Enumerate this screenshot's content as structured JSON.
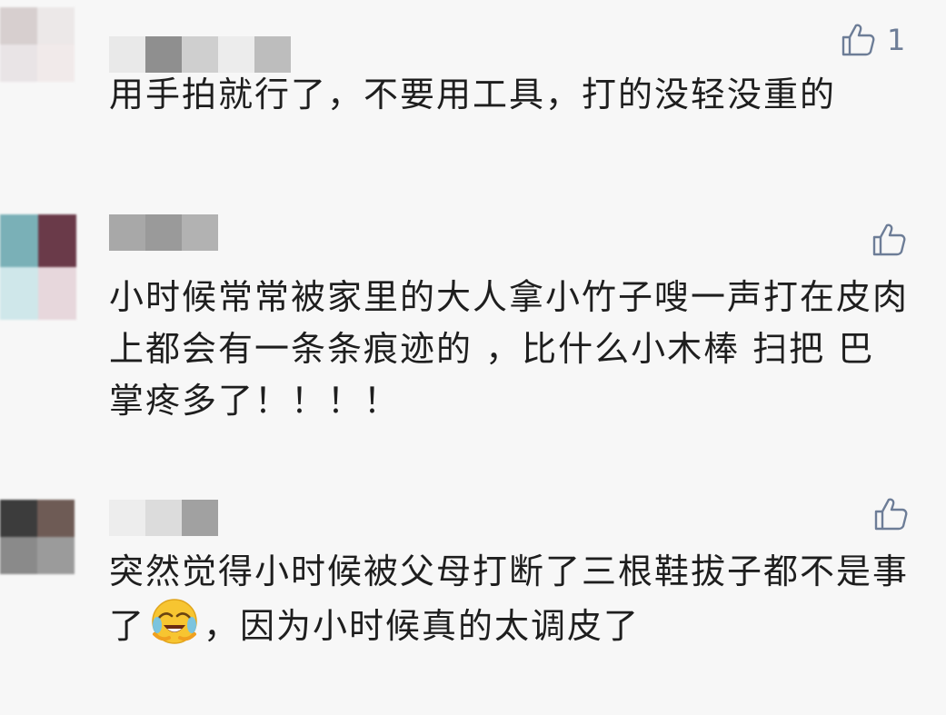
{
  "comments": [
    {
      "text_before": "用手拍就行了，不要用工具，打的没轻没重的",
      "text_after": "",
      "like_count": "1",
      "emoji": ""
    },
    {
      "text_before": "小时候常常被家里的大人拿小竹子嗖一声打在皮肉上都会有一条条痕迹的 ，比什么小木棒 扫把 巴掌疼多了！！！！",
      "text_after": "",
      "like_count": "",
      "emoji": ""
    },
    {
      "text_before": "突然觉得小时候被父母打断了三根鞋拔子都不是事了",
      "text_after": "，因为小时候真的太调皮了",
      "like_count": "",
      "emoji": "laughing-crying-emoji"
    }
  ],
  "colors": {
    "background": "#f7f7f7",
    "text": "#1e1e1e",
    "like_icon": "#6d7d97"
  }
}
